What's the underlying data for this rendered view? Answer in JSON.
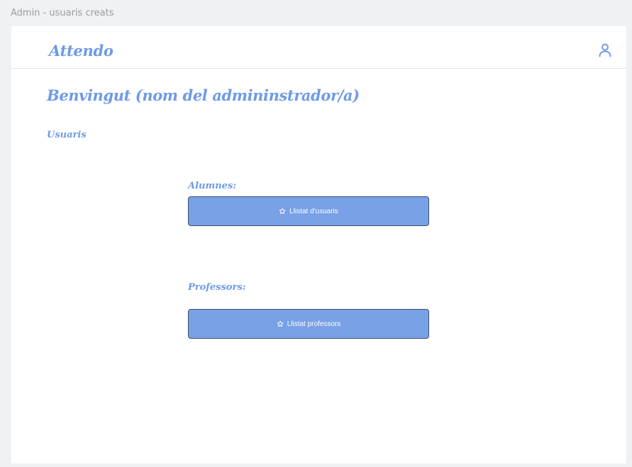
{
  "frame": {
    "title": "Admin - usuaris creats"
  },
  "header": {
    "brand": "Attendo",
    "user_icon": "user-icon"
  },
  "main": {
    "welcome": "Benvingut (nom del admininstrador/a)",
    "section_title": "Usuaris",
    "groups": [
      {
        "label": "Alumnes:",
        "button_label": "Llistat d'usuaris",
        "button_icon": "star-icon"
      },
      {
        "label": "Professors:",
        "button_label": "Llistat professors",
        "button_icon": "star-icon"
      }
    ]
  },
  "colors": {
    "accent": "#6f9ae6",
    "button_fill": "#78a1e6",
    "button_border": "#3f4d6b",
    "background": "#f0f1f3"
  }
}
